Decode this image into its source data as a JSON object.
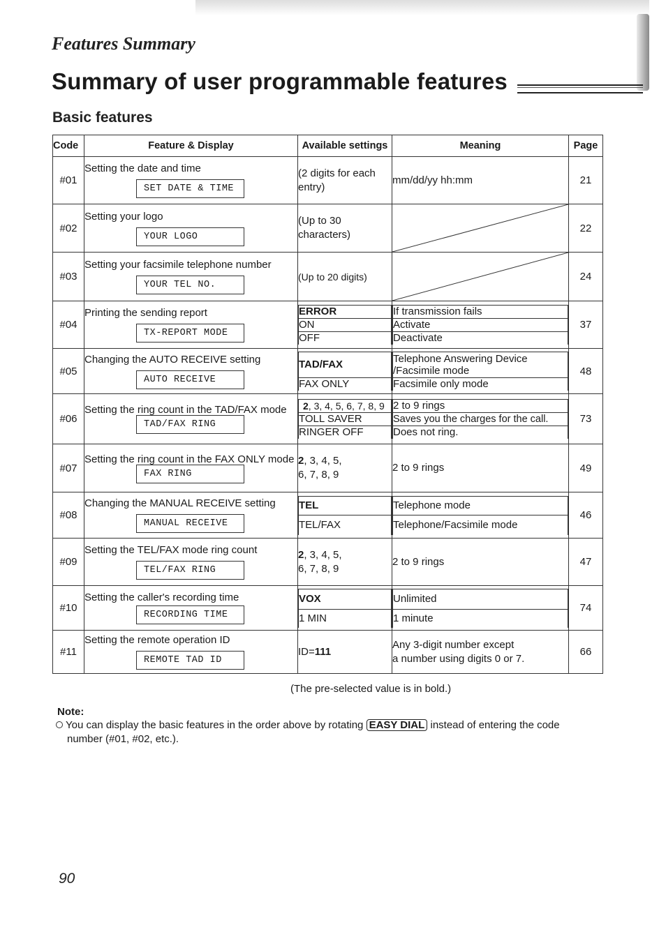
{
  "header": {
    "section_label": "Features Summary",
    "title": "Summary of user programmable features",
    "subtitle": "Basic features"
  },
  "table": {
    "columns": [
      "Code",
      "Feature & Display",
      "Available settings",
      "Meaning",
      "Page"
    ],
    "rows": [
      {
        "code": "#01",
        "feature": "Setting the date and time",
        "display": "SET DATE & TIME",
        "settings": [
          "(2 digits for each entry)"
        ],
        "meanings": [
          "mm/dd/yy  hh:mm"
        ],
        "page": "21"
      },
      {
        "code": "#02",
        "feature": "Setting your logo",
        "display": "YOUR LOGO",
        "settings": [
          "(Up to 30 characters)"
        ],
        "meanings": [],
        "page": "22"
      },
      {
        "code": "#03",
        "feature": "Setting your facsimile telephone number",
        "display": "YOUR TEL NO.",
        "settings": [
          "(Up to 20 digits)"
        ],
        "meanings": [],
        "page": "24"
      },
      {
        "code": "#04",
        "feature": "Printing the sending report",
        "display": "TX-REPORT MODE",
        "settings": [
          "ERROR",
          "ON",
          "OFF"
        ],
        "meanings": [
          "If transmission fails",
          "Activate",
          "Deactivate"
        ],
        "default": "ERROR",
        "page": "37"
      },
      {
        "code": "#05",
        "feature": "Changing the AUTO RECEIVE setting",
        "display": "AUTO RECEIVE",
        "settings": [
          "TAD/FAX",
          "FAX ONLY"
        ],
        "meanings": [
          "Telephone Answering Device /Facsimile mode",
          "Facsimile only mode"
        ],
        "default": "TAD/FAX",
        "page": "48"
      },
      {
        "code": "#06",
        "feature": "Setting the ring count in the TAD/FAX mode",
        "display": "TAD/FAX RING",
        "settings_first_bold": "2",
        "settings": [
          ", 3, 4, 5, 6, 7, 8, 9",
          "TOLL SAVER",
          "RINGER OFF"
        ],
        "meanings": [
          "2 to 9 rings",
          "Saves you the charges for the call.",
          "Does not ring."
        ],
        "page": "73"
      },
      {
        "code": "#07",
        "feature": "Setting the ring count in the FAX ONLY mode",
        "display": "FAX RING",
        "settings_first_bold": "2",
        "settings": [
          ", 3, 4, 5,",
          "6, 7, 8, 9"
        ],
        "meanings": [
          "2 to 9 rings"
        ],
        "page": "49"
      },
      {
        "code": "#08",
        "feature": "Changing the MANUAL RECEIVE setting",
        "display": "MANUAL RECEIVE",
        "settings": [
          "TEL",
          "TEL/FAX"
        ],
        "meanings": [
          "Telephone mode",
          "Telephone/Facsimile mode"
        ],
        "default": "TEL",
        "page": "46"
      },
      {
        "code": "#09",
        "feature": "Setting the TEL/FAX mode ring count",
        "display": "TEL/FAX RING",
        "settings_first_bold": "2",
        "settings": [
          ", 3, 4, 5,",
          "6, 7, 8, 9"
        ],
        "meanings": [
          "2 to 9 rings"
        ],
        "page": "47"
      },
      {
        "code": "#10",
        "feature": "Setting the caller's recording time",
        "display": "RECORDING TIME",
        "settings": [
          "VOX",
          "1 MIN"
        ],
        "meanings": [
          "Unlimited",
          "1 minute"
        ],
        "default": "VOX",
        "page": "74"
      },
      {
        "code": "#11",
        "feature": "Setting the remote operation ID",
        "display": "REMOTE TAD ID",
        "settings_prefix": "ID=",
        "settings": [
          "111"
        ],
        "meanings": [
          "Any 3-digit number except",
          "a number using digits 0 or 7."
        ],
        "page": "66"
      }
    ]
  },
  "footer": {
    "preselect_note": "(The pre-selected value is in bold.)",
    "note_label": "Note:",
    "note_before_key": "You can display the basic features in the order above by rotating",
    "note_key": "EASY DIAL",
    "note_after_key": "instead of entering the code",
    "note_line2": "number (#01, #02, etc.).",
    "page_number": "90"
  }
}
